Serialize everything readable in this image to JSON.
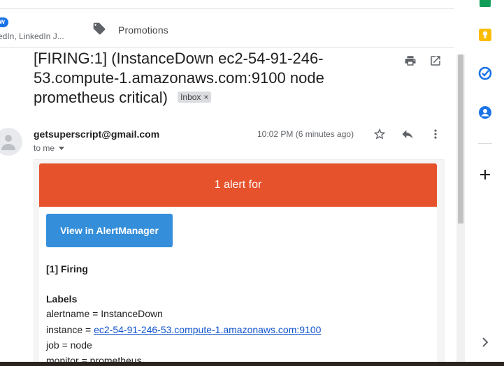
{
  "tabs": {
    "social_badge": "w",
    "social_preview": "edIn, LinkedIn J...",
    "promotions_label": "Promotions"
  },
  "email": {
    "subject": "[FIRING:1] (InstanceDown ec2-54-91-246-53.compute-1.amazonaws.com:9100 node prometheus critical)",
    "label_chip": "Inbox",
    "label_chip_close": "×",
    "sender": "getsuperscript@gmail.com",
    "recipient": "to me",
    "time": "10:02 PM (6 minutes ago)"
  },
  "body": {
    "banner": "1 alert for",
    "button_label": "View in AlertManager",
    "firing_heading": "[1] Firing",
    "labels_heading": "Labels",
    "labels": [
      "alertname = InstanceDown",
      "instance = ",
      "job = node",
      "monitor = prometheus"
    ],
    "instance_link": "ec2-54-91-246-53.compute-1.amazonaws.com:9100"
  },
  "icons": {
    "print": "print-icon",
    "open_new_window": "open-in-new-window-icon",
    "star": "star-icon",
    "reply": "reply-icon",
    "more": "more-vert-icon",
    "tag": "tag-icon",
    "keep": "keep-icon",
    "tasks": "tasks-icon",
    "contacts": "contacts-icon",
    "add": "plus-icon",
    "expand": "chevron-right-icon"
  },
  "colors": {
    "banner": "#e6522c",
    "button": "#348eda",
    "link": "#1155cc",
    "keep": "#fbbc04",
    "tasks": "#1a73e8",
    "contacts": "#1a73e8"
  }
}
